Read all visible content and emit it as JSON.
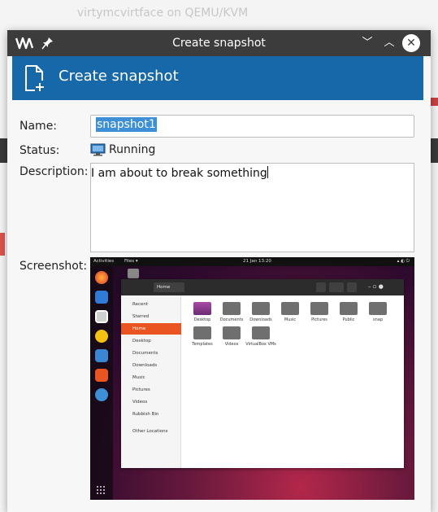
{
  "background_window": {
    "title": "virtymcvirtface on QEMU/KVM"
  },
  "dialog": {
    "title": "Create snapshot",
    "header_title": "Create snapshot",
    "buttons": {
      "minimize": "﹀",
      "maximize": "︿",
      "close": "✕"
    }
  },
  "form": {
    "name_label": "Name:",
    "name_value": "snapshot1",
    "status_label": "Status:",
    "status_value": "Running",
    "description_label": "Description:",
    "description_value": "I am about to break something",
    "screenshot_label": "Screenshot:"
  },
  "thumbnail": {
    "top_bar": {
      "activities": "Activities",
      "files": "Files ▾",
      "clock": "21 Jan 13:20"
    },
    "path": "Home",
    "sidebar": [
      "Recent",
      "Starred",
      "Home",
      "Desktop",
      "Documents",
      "Downloads",
      "Music",
      "Pictures",
      "Videos",
      "Rubbish Bin",
      "Other Locations"
    ],
    "selected_sidebar": "Home",
    "folders_row1": [
      "Desktop",
      "Documents",
      "Downloads",
      "Music",
      "Pictures",
      "Public",
      "snap"
    ],
    "folders_row2": [
      "Templates",
      "Videos",
      "VirtualBox VMs"
    ]
  },
  "colors": {
    "titlebar": "#3c3c3c",
    "header_band": "#1668a9",
    "selection": "#3d8fd6",
    "ubuntu_orange": "#e95420"
  }
}
